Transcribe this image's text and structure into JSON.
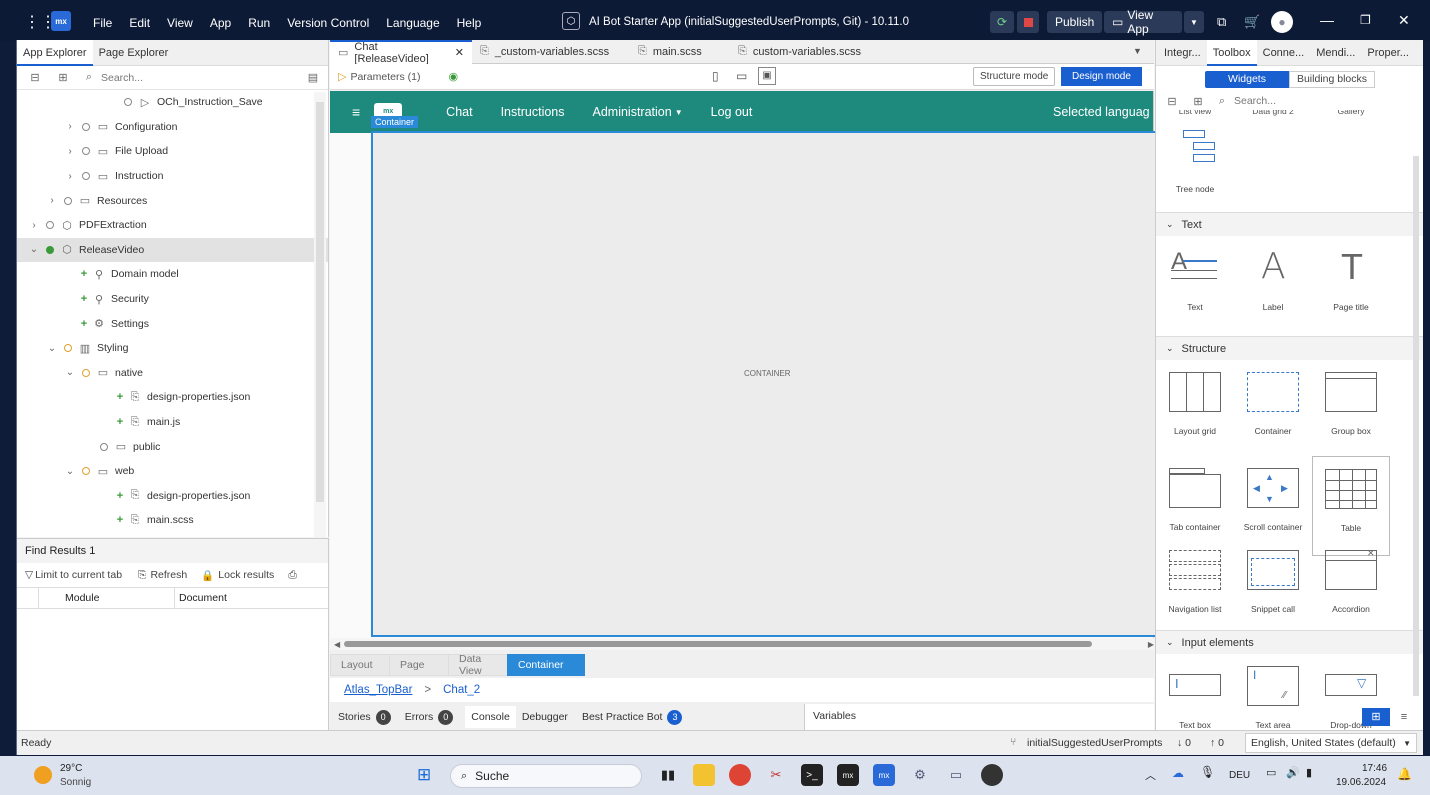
{
  "titlebar": {
    "logo": "mx",
    "menu": [
      "File",
      "Edit",
      "View",
      "App",
      "Run",
      "Version Control",
      "Language",
      "Help"
    ],
    "title": "AI Bot Starter App (initialSuggestedUserPrompts, Git)  -  10.11.0",
    "publish": "Publish",
    "view_app": "View App"
  },
  "left": {
    "tabs": [
      "App Explorer",
      "Page Explorer"
    ],
    "search_placeholder": "Search...",
    "tree": [
      {
        "indent": 88,
        "chev": "",
        "dot": "",
        "icon": "▷",
        "label": "OCh_Instruction_Save"
      },
      {
        "indent": 46,
        "chev": "›",
        "dot": "",
        "icon": "▭",
        "label": "Configuration"
      },
      {
        "indent": 46,
        "chev": "›",
        "dot": "",
        "icon": "▭",
        "label": "File Upload"
      },
      {
        "indent": 46,
        "chev": "›",
        "dot": "",
        "icon": "▭",
        "label": "Instruction"
      },
      {
        "indent": 28,
        "chev": "›",
        "dot": "",
        "icon": "▭",
        "label": "Resources"
      },
      {
        "indent": 10,
        "chev": "›",
        "dot": "",
        "icon": "⬡",
        "label": "PDFExtraction"
      },
      {
        "indent": 10,
        "chev": "⌄",
        "dot": "g",
        "icon": "⬡",
        "label": "ReleaseVideo"
      },
      {
        "indent": 46,
        "chev": "",
        "dot": "plus",
        "icon": "⚲",
        "label": "Domain model"
      },
      {
        "indent": 46,
        "chev": "",
        "dot": "plus",
        "icon": "⚲",
        "label": "Security"
      },
      {
        "indent": 46,
        "chev": "",
        "dot": "plus",
        "icon": "⚙",
        "label": "Settings"
      },
      {
        "indent": 28,
        "chev": "⌄",
        "dot": "o",
        "icon": "▥",
        "label": "Styling"
      },
      {
        "indent": 46,
        "chev": "⌄",
        "dot": "o",
        "icon": "▭",
        "label": "native"
      },
      {
        "indent": 82,
        "chev": "",
        "dot": "plus",
        "icon": "⎘",
        "label": "design-properties.json"
      },
      {
        "indent": 82,
        "chev": "",
        "dot": "plus",
        "icon": "⎘",
        "label": "main.js"
      },
      {
        "indent": 64,
        "chev": "",
        "dot": "",
        "icon": "▭",
        "label": "public"
      },
      {
        "indent": 46,
        "chev": "⌄",
        "dot": "o",
        "icon": "▭",
        "label": "web"
      },
      {
        "indent": 82,
        "chev": "",
        "dot": "plus",
        "icon": "⎘",
        "label": "design-properties.json"
      },
      {
        "indent": 82,
        "chev": "",
        "dot": "plus",
        "icon": "⎘",
        "label": "main.scss"
      }
    ],
    "find": {
      "tab": "Find Results 1",
      "limit": "Limit to current tab",
      "refresh": "Refresh",
      "lock": "Lock results",
      "col_module": "Module",
      "col_document": "Document"
    }
  },
  "center": {
    "tabs": [
      {
        "label": "Chat [ReleaseVideo]",
        "active": true,
        "close": "✕"
      },
      {
        "label": "_custom-variables.scss",
        "active": false
      },
      {
        "label": "main.scss",
        "active": false
      },
      {
        "label": "custom-variables.scss",
        "active": false
      }
    ],
    "params": "Parameters (1)",
    "structure_mode": "Structure mode",
    "design_mode": "Design mode",
    "nav": {
      "logo": "mx",
      "items": [
        "Chat",
        "Instructions",
        "Administration",
        "Log out"
      ],
      "right": "Selected languag"
    },
    "container_tag": "Container",
    "canvas_label": "CONTAINER",
    "breadcrumb": [
      "Layout",
      "Page",
      "Data View",
      "Container"
    ],
    "path": {
      "link": "Atlas_TopBar",
      "sep": ">",
      "page": "Chat_2"
    },
    "bottom_tabs": {
      "stories": "Stories",
      "stories_count": "0",
      "errors": "Errors",
      "errors_count": "0",
      "console": "Console",
      "debugger": "Debugger",
      "bpb": "Best Practice Bot",
      "bpb_count": "3",
      "variables": "Variables"
    }
  },
  "right": {
    "tabs": [
      "Integr...",
      "Toolbox",
      "Conne...",
      "Mendi...",
      "Proper..."
    ],
    "seg": [
      "Widgets",
      "Building blocks"
    ],
    "search_placeholder": "Search...",
    "top_cut": [
      "List view",
      "Data grid 2",
      "Gallery"
    ],
    "tree_node": "Tree node",
    "sections": {
      "text": "Text",
      "structure": "Structure",
      "input": "Input elements"
    },
    "text_widgets": [
      "Text",
      "Label",
      "Page title"
    ],
    "struct_row1": [
      "Layout grid",
      "Container",
      "Group box"
    ],
    "struct_row2": [
      "Tab container",
      "Scroll container",
      "Table"
    ],
    "struct_row3": [
      "Navigation list",
      "Snippet call",
      "Accordion"
    ],
    "input_widgets": [
      "Text box",
      "Text area",
      "Drop-down"
    ]
  },
  "status": {
    "left": "Ready",
    "branch": "initialSuggestedUserPrompts",
    "down": "↓ 0",
    "up": "↑ 0",
    "lang": "English, United States (default)"
  },
  "taskbar": {
    "temp": "29°C",
    "weather": "Sonnig",
    "search": "Suche",
    "lang": "DEU",
    "time": "17:46",
    "date": "19.06.2024"
  },
  "colors": {
    "nav": "#1e8a7e",
    "accent": "#1a5fd0",
    "container": "#2a8ad8"
  }
}
